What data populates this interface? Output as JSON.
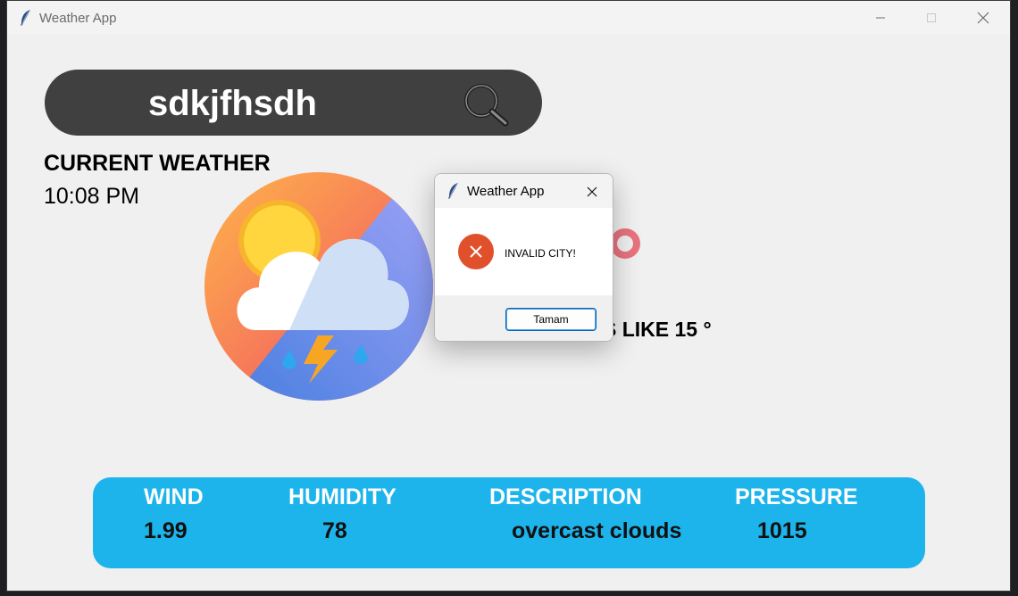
{
  "window": {
    "title": "Weather App"
  },
  "search": {
    "value": "sdkjfhsdh",
    "icon": "search-icon"
  },
  "current": {
    "label": "CURRENT WEATHER",
    "time": "10:08 PM"
  },
  "main": {
    "feels_like": "S LIKE 15 °",
    "weather_icon": "thunderstorm-cloud-sun-icon"
  },
  "info": {
    "wind_label": "WIND",
    "wind_value": "1.99",
    "humidity_label": "HUMIDITY",
    "humidity_value": "78",
    "description_label": "DESCRIPTION",
    "description_value": "overcast clouds",
    "pressure_label": "PRESSURE",
    "pressure_value": "1015"
  },
  "dialog": {
    "title": "Weather App",
    "message": "INVALID CITY!",
    "ok_label": "Tamam",
    "icon": "error-icon"
  },
  "colors": {
    "search_bg": "#404040",
    "info_bar_bg": "#1db4ec",
    "error": "#e0502a"
  }
}
